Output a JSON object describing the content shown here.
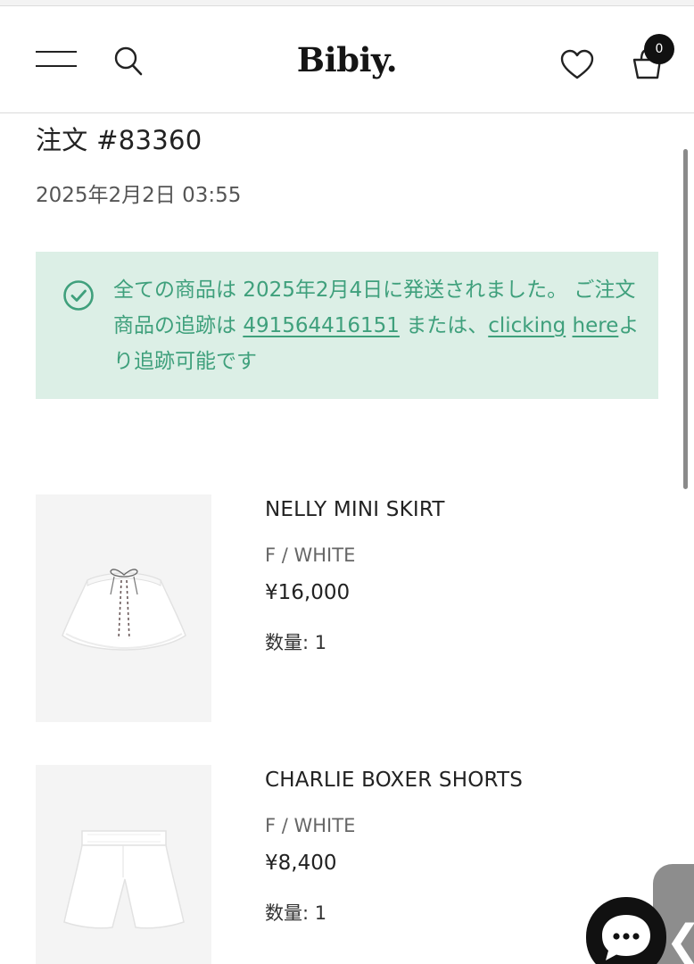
{
  "header": {
    "logo": "Bibiy.",
    "cart_count": "0",
    "icons": [
      "menu-icon",
      "search-icon",
      "heart-icon",
      "cart-icon"
    ]
  },
  "order": {
    "title": "注文 #83360",
    "date": "2025年2月2日 03:55"
  },
  "notice": {
    "icon": "check-circle-icon",
    "text_before": "全ての商品は 2025年2月4日に発送されました。 ご注文商品の追跡は ",
    "tracking_number": "491564416151",
    "text_middle": " または、",
    "link_text_1": "clicking",
    "link_text_2": "here",
    "text_after": "より追跡可能です",
    "color": "#3fa07c",
    "background": "#dcefe6"
  },
  "items": [
    {
      "name": "NELLY MINI SKIRT",
      "variant": "F / WHITE",
      "price": "¥16,000",
      "qty": "数量: 1"
    },
    {
      "name": "CHARLIE BOXER SHORTS",
      "variant": "F / WHITE",
      "price": "¥8,400",
      "qty": "数量: 1"
    }
  ],
  "widgets": {
    "chat_icon": "chat-bubble-icon",
    "side_tab_glyph": "❮"
  }
}
